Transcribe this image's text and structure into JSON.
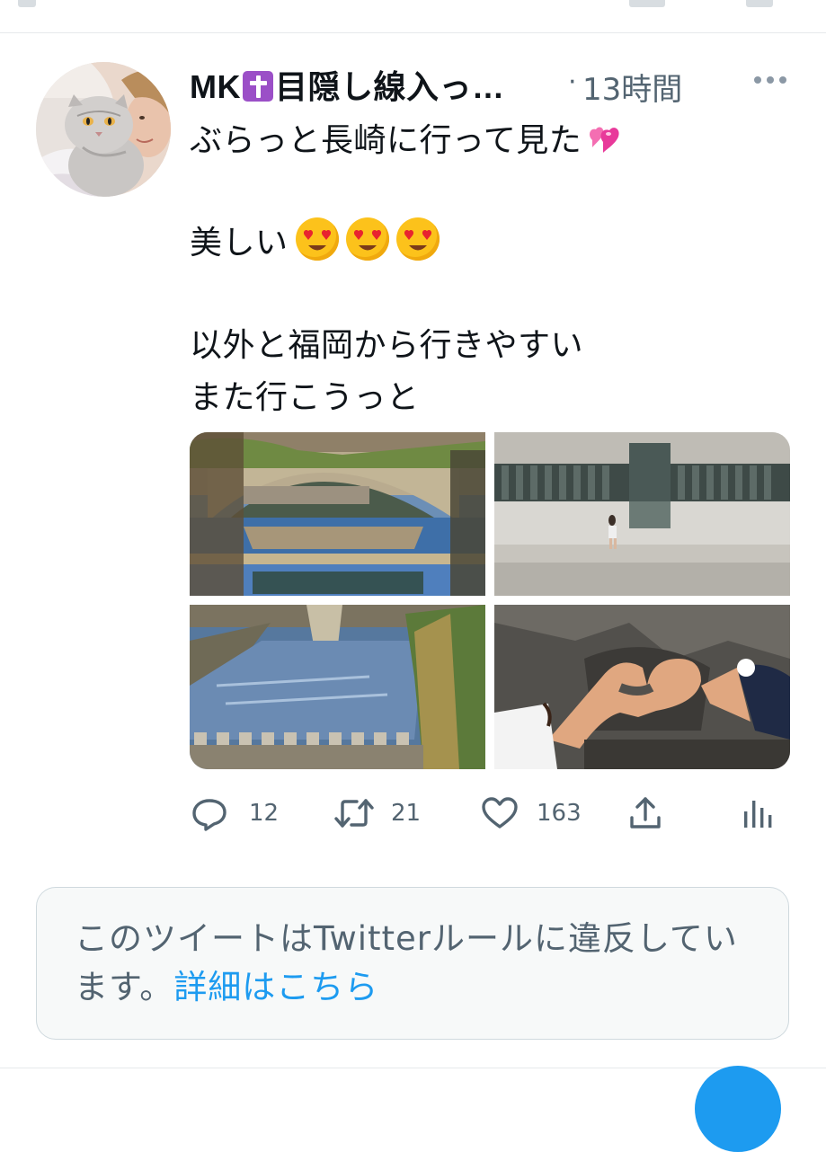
{
  "tweet": {
    "author_name": "MK",
    "author_name_suffix": "目隠し線入っ…",
    "separator": "·",
    "timestamp": "13時間",
    "text_lines": [
      "ぶらっと長崎に行って見た",
      "",
      "美しい",
      "",
      "以外と福岡から行きやすい",
      "また行こうっと"
    ],
    "emojis": [
      "two-hearts",
      "heart-eyes",
      "heart-eyes",
      "heart-eyes"
    ],
    "media": [
      {
        "name": "stone-bridge-photo",
        "position": "top-left"
      },
      {
        "name": "martyrs-monument-photo",
        "position": "top-right"
      },
      {
        "name": "river-photo",
        "position": "bottom-left"
      },
      {
        "name": "heart-hands-photo",
        "position": "bottom-right"
      }
    ],
    "actions": {
      "reply_count": "12",
      "retweet_count": "21",
      "like_count": "163"
    }
  },
  "notice": {
    "text": "このツイートはTwitterルールに違反しています。",
    "link_label": "詳細はこちら"
  },
  "colors": {
    "accent": "#1d9bf0",
    "secondary_text": "#536471",
    "primary_text": "#0f1419",
    "notice_background": "#f7f9f9"
  }
}
